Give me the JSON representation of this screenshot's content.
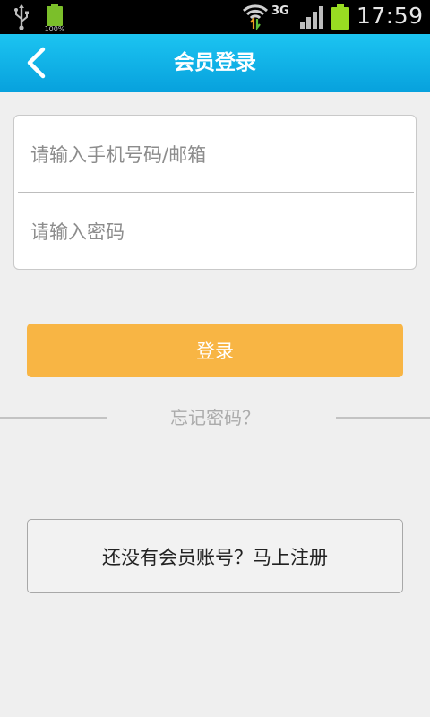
{
  "status_bar": {
    "battery_small_label": "100%",
    "network_type": "3G",
    "time": "17:59"
  },
  "header": {
    "title": "会员登录",
    "back_icon": "chevron-left-icon"
  },
  "form": {
    "account_placeholder": "请输入手机号码/邮箱",
    "password_placeholder": "请输入密码"
  },
  "actions": {
    "login_label": "登录",
    "forgot_label": "忘记密码？",
    "register_label": "还没有会员账号？马上注册"
  },
  "colors": {
    "header_top": "#1cc4f1",
    "header_bottom": "#07a1dd",
    "login_button": "#f8b544",
    "background": "#efefef"
  }
}
